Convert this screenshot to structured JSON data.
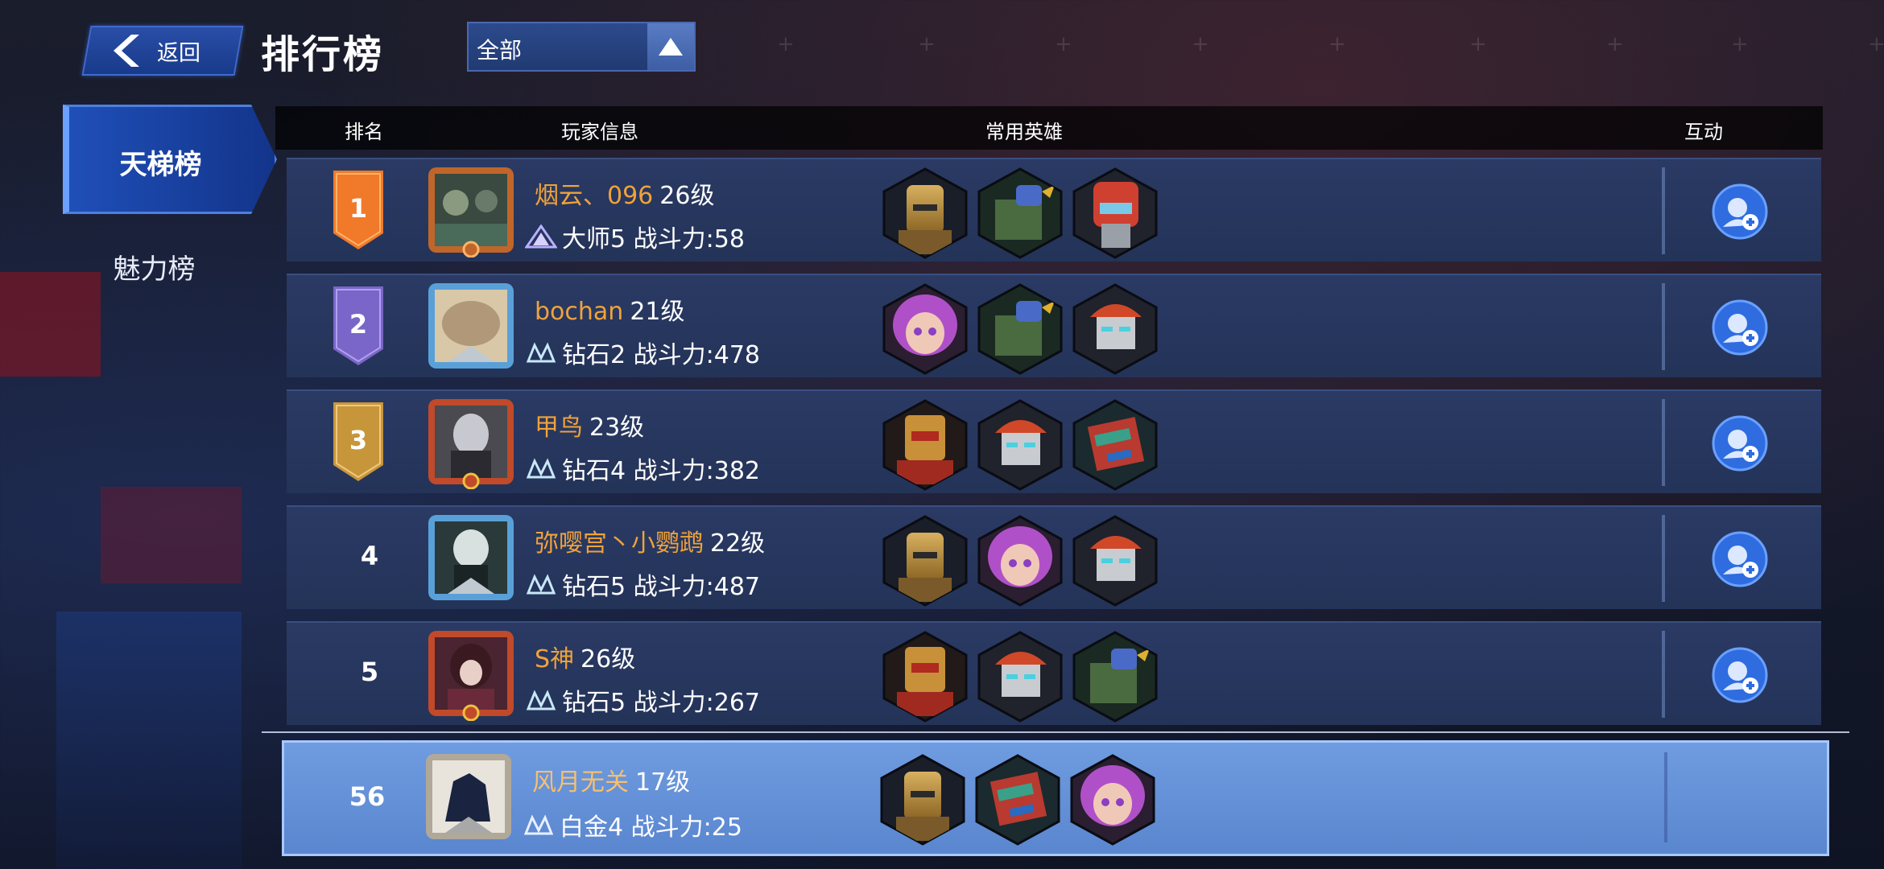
{
  "header": {
    "back_label": "返回",
    "title": "排行榜",
    "filter_value": "全部"
  },
  "tabs": [
    {
      "label": "天梯榜",
      "active": true
    },
    {
      "label": "魅力榜",
      "active": false
    }
  ],
  "columns": {
    "rank": "排名",
    "player": "玩家信息",
    "heroes": "常用英雄",
    "interact": "互动"
  },
  "rows": [
    {
      "rank": "1",
      "name": "烟云、096",
      "level": "26级",
      "tier": "大师5",
      "power": "战斗力:58",
      "badge_color": "#f07a2a",
      "heroes": [
        "gold-knight-robot",
        "green-mech",
        "red-helmet-robot"
      ]
    },
    {
      "rank": "2",
      "name": "bochan",
      "level": "21级",
      "tier": "钻石2",
      "power": "战斗力:478",
      "badge_color": "#7a66c8",
      "heroes": [
        "purple-hair-girl",
        "green-mech",
        "red-cap-robot"
      ]
    },
    {
      "rank": "3",
      "name": "甲鸟",
      "level": "23级",
      "tier": "钻石4",
      "power": "战斗力:382",
      "badge_color": "#c8963a",
      "heroes": [
        "red-gold-robot",
        "red-cap-robot",
        "box-robot"
      ]
    },
    {
      "rank": "4",
      "name": "弥嘤宫丶小鹦鹉",
      "level": "22级",
      "tier": "钻石5",
      "power": "战斗力:487",
      "heroes": [
        "gold-knight-robot",
        "purple-hair-girl",
        "red-cap-robot"
      ]
    },
    {
      "rank": "5",
      "name": "S神",
      "level": "26级",
      "tier": "钻石5",
      "power": "战斗力:267",
      "heroes": [
        "red-gold-robot",
        "red-cap-robot",
        "green-mech"
      ]
    }
  ],
  "self_row": {
    "rank": "56",
    "name": "风月无关",
    "level": "17级",
    "tier": "白金4",
    "power": "战斗力:25",
    "heroes": [
      "gold-knight-robot",
      "box-robot",
      "purple-hair-girl"
    ]
  },
  "colors": {
    "accent": "#3f6ad0",
    "name_orange": "#f0a23a",
    "self_row_bg": "#6f9ce0"
  }
}
